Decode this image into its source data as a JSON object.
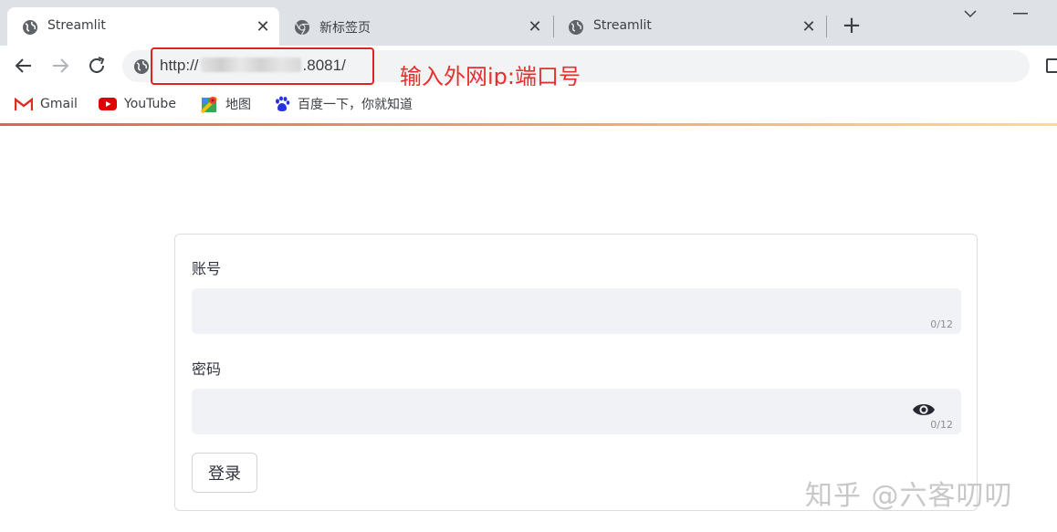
{
  "tabs": [
    {
      "title": "Streamlit",
      "favicon": "globe-icon",
      "active": true
    },
    {
      "title": "新标签页",
      "favicon": "chrome-icon",
      "active": false
    },
    {
      "title": "Streamlit",
      "favicon": "globe-icon",
      "active": false
    }
  ],
  "toolbar": {
    "url_prefix": "http://",
    "url_suffix": ".8081/"
  },
  "annotation": {
    "text": "输入外网ip:端口号",
    "color": "#e53030"
  },
  "bookmarks": [
    {
      "label": "Gmail",
      "icon": "gmail-icon"
    },
    {
      "label": "YouTube",
      "icon": "youtube-icon"
    },
    {
      "label": "地图",
      "icon": "maps-icon"
    },
    {
      "label": "百度一下，你就知道",
      "icon": "baidu-icon"
    }
  ],
  "form": {
    "username_label": "账号",
    "username_value": "",
    "username_counter": "0/12",
    "password_label": "密码",
    "password_value": "",
    "password_counter": "0/12",
    "login_label": "登录"
  },
  "watermark": "知乎 @六客叨叨"
}
